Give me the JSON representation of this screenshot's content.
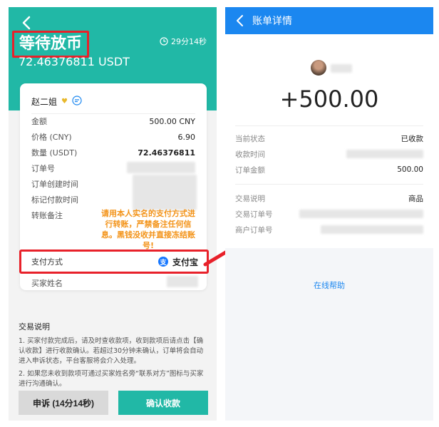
{
  "left": {
    "status_title": "等待放币",
    "amount_usdt": "72.46376811 USDT",
    "timer": "29分14秒",
    "seller_name": "赵二姐",
    "rows": {
      "amount_label": "金额",
      "amount_value": "500.00 CNY",
      "price_label": "价格 (CNY)",
      "price_value": "6.90",
      "qty_label": "数量 (USDT)",
      "qty_value": "72.46376811",
      "order_no_label": "订单号",
      "created_label": "订单创建时间",
      "paid_label": "标记付款时间",
      "remark_label": "转账备注"
    },
    "remark_warning": "请用本人实名的支付方式进行转账，严禁备注任何信息。黑钱没收并直接冻结账号!",
    "pay_method_label": "支付方式",
    "pay_method_value": "支付宝",
    "alipay_glyph": "支",
    "buyer_name_label": "买家姓名",
    "notes_title": "交易说明",
    "notes": [
      "1. 买家付款完成后，请及时查收款项，收到款项后请点击【确认收款】进行收款确认。若超过30分钟未确认，订单将会自动进入申诉状态，平台客服将会介入处理。",
      "2. 如果您未收到款项可通过买家姓名旁“联系对方”图标与买家进行沟通确认。"
    ],
    "appeal_button": "申诉 (14分14秒)",
    "confirm_button": "确认收款",
    "colors": {
      "teal": "#21b8a6",
      "warning": "#f39318",
      "highlight": "#e8212a"
    }
  },
  "right": {
    "title": "账单详情",
    "amount": "+500.00",
    "rows": {
      "status_label": "当前状态",
      "status_value": "已收款",
      "time_label": "收款时间",
      "total_label": "订单金额",
      "total_value": "500.00",
      "desc_label": "交易说明",
      "desc_value": "商品",
      "trade_no_label": "交易订单号",
      "merchant_no_label": "商户订单号"
    },
    "help_link": "在线帮助",
    "colors": {
      "blue": "#1b87f0"
    }
  }
}
